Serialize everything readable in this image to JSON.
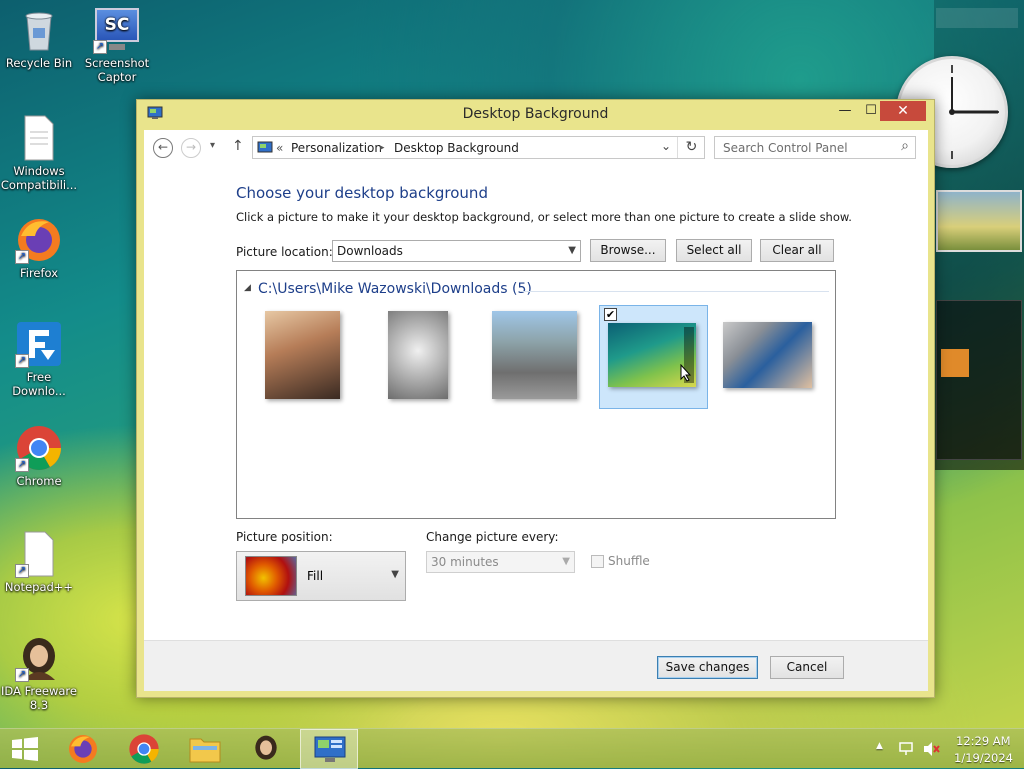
{
  "desktop": {
    "icons": [
      {
        "label": "Recycle Bin"
      },
      {
        "label": "Screenshot Captor"
      },
      {
        "label": "Windows Compatibili..."
      },
      {
        "label": "Firefox"
      },
      {
        "label": "Free Downlo..."
      },
      {
        "label": "Chrome"
      },
      {
        "label": "Notepad++"
      },
      {
        "label": "IDA Freeware 8.3"
      }
    ],
    "screenshot_captor_badge": "SC"
  },
  "window": {
    "title": "Desktop Background",
    "controls": {
      "minimize": "—",
      "maximize": "☐",
      "close": "✕"
    }
  },
  "navbar": {
    "back_icon": "←",
    "forward_icon": "→",
    "recent_icon": "▾",
    "up_icon": "↑",
    "breadcrumb": {
      "overflow": "«",
      "item1": "Personalization",
      "separator": "▸",
      "item2": "Desktop Background"
    },
    "dropdown_icon": "⌄",
    "refresh_icon": "↻",
    "search_placeholder": "Search Control Panel",
    "search_icon": "⌕"
  },
  "content": {
    "heading": "Choose your desktop background",
    "description": "Click a picture to make it your desktop background, or select more than one picture to create a slide show.",
    "picture_location_label": "Picture location:",
    "picture_location_value": "Downloads",
    "browse_button": "Browse...",
    "select_all_button": "Select all",
    "clear_all_button": "Clear all",
    "group_header": "C:\\Users\\Mike Wazowski\\Downloads (5)",
    "group_toggle": "◢",
    "selected_checkmark": "✔",
    "picture_position_label": "Picture position:",
    "picture_position_value": "Fill",
    "change_every_label": "Change picture every:",
    "change_every_value": "30 minutes",
    "shuffle_label": "Shuffle",
    "shuffle_checked": false
  },
  "footer": {
    "save_button": "Save changes",
    "cancel_button": "Cancel"
  },
  "taskbar": {
    "tray_arrow": "▲",
    "time": "12:29 AM",
    "date": "1/19/2024"
  }
}
